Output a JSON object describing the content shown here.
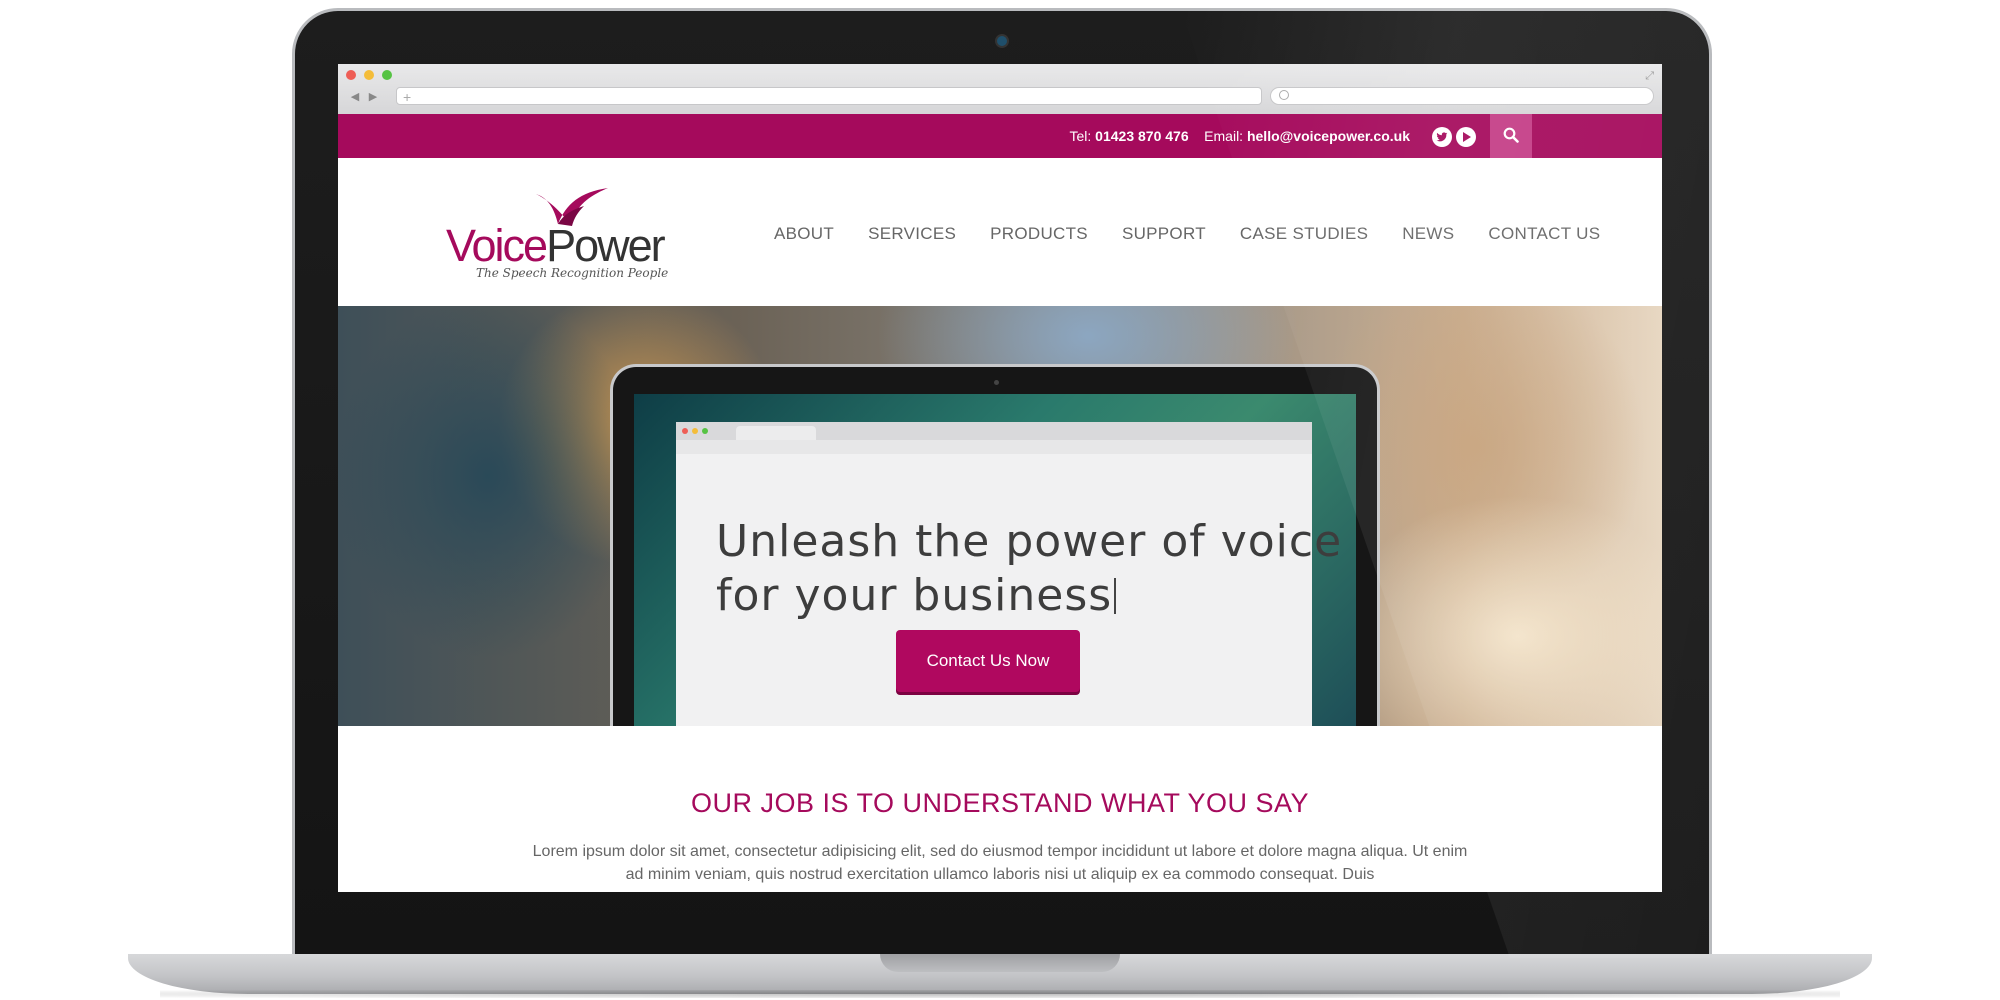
{
  "browser": {
    "url_placeholder": "+",
    "back_glyph": "◀",
    "forward_glyph": "▶",
    "expand_glyph": "⤢"
  },
  "topbar": {
    "tel_label": "Tel:",
    "tel_value": "01423 870 476",
    "email_label": "Email:",
    "email_value": "hello@voicepower.co.uk",
    "icons": [
      "twitter-icon",
      "youtube-icon",
      "search-icon"
    ],
    "bg_color": "#a50a5c"
  },
  "logo": {
    "voice": "Voice",
    "power": "Power",
    "tagline": "The Speech Recognition People"
  },
  "nav": {
    "items": [
      "ABOUT",
      "SERVICES",
      "PRODUCTS",
      "SUPPORT",
      "CASE STUDIES",
      "NEWS",
      "CONTACT US"
    ]
  },
  "hero": {
    "headline_line1": "Unleash the power of voice",
    "headline_line2": "for your business",
    "cta_label": "Contact Us Now"
  },
  "section": {
    "title": "OUR JOB IS TO UNDERSTAND WHAT YOU SAY",
    "body": "Lorem ipsum dolor sit amet, consectetur adipisicing elit, sed do eiusmod tempor incididunt ut labore et dolore magna aliqua. Ut enim ad minim veniam, quis nostrud exercitation ullamco laboris nisi ut aliquip ex ea commodo consequat. Duis"
  },
  "colors": {
    "brand": "#a50a5c",
    "accent": "#b0085f"
  }
}
